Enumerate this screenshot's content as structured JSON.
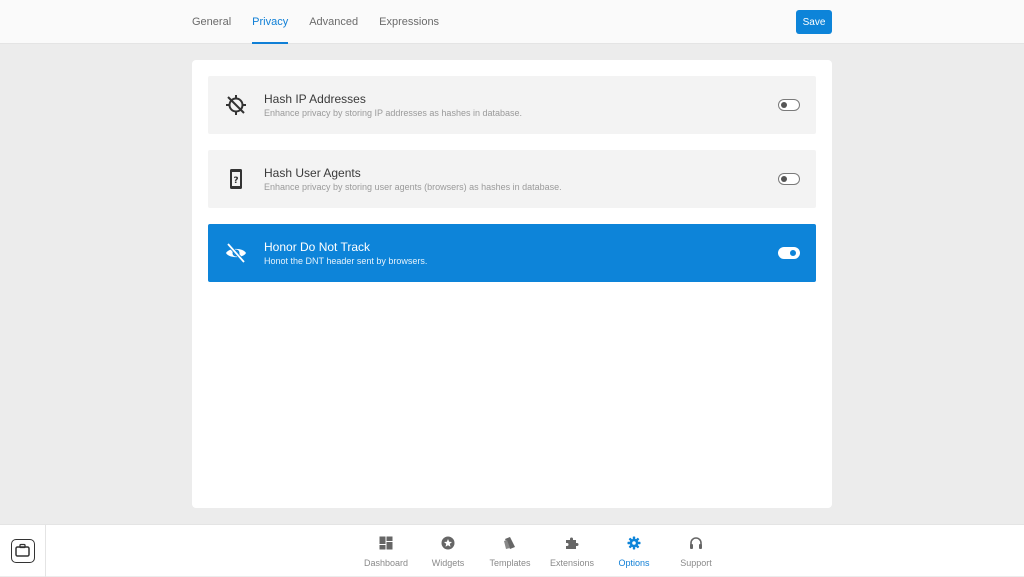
{
  "header": {
    "tabs": [
      {
        "label": "General",
        "active": false
      },
      {
        "label": "Privacy",
        "active": true
      },
      {
        "label": "Advanced",
        "active": false
      },
      {
        "label": "Expressions",
        "active": false
      }
    ],
    "save_label": "Save"
  },
  "settings": [
    {
      "icon": "gps-off-icon",
      "title": "Hash IP Addresses",
      "description": "Enhance privacy by storing IP addresses as hashes in database.",
      "enabled": false
    },
    {
      "icon": "device-unknown-icon",
      "title": "Hash User Agents",
      "description": "Enhance privacy by storing user agents (browsers) as hashes in database.",
      "enabled": false
    },
    {
      "icon": "eye-off-icon",
      "title": "Honor Do Not Track",
      "description": "Honot the DNT header sent by browsers.",
      "enabled": true
    }
  ],
  "bottom_nav": {
    "items": [
      {
        "label": "Dashboard",
        "icon": "dashboard-icon",
        "active": false
      },
      {
        "label": "Widgets",
        "icon": "widgets-star-icon",
        "active": false
      },
      {
        "label": "Templates",
        "icon": "templates-icon",
        "active": false
      },
      {
        "label": "Extensions",
        "icon": "puzzle-icon",
        "active": false
      },
      {
        "label": "Options",
        "icon": "gear-icon",
        "active": true
      },
      {
        "label": "Support",
        "icon": "headphones-icon",
        "active": false
      }
    ]
  },
  "colors": {
    "accent": "#0d84d9",
    "row_background": "#f3f3f3",
    "page_background": "#ececec"
  }
}
